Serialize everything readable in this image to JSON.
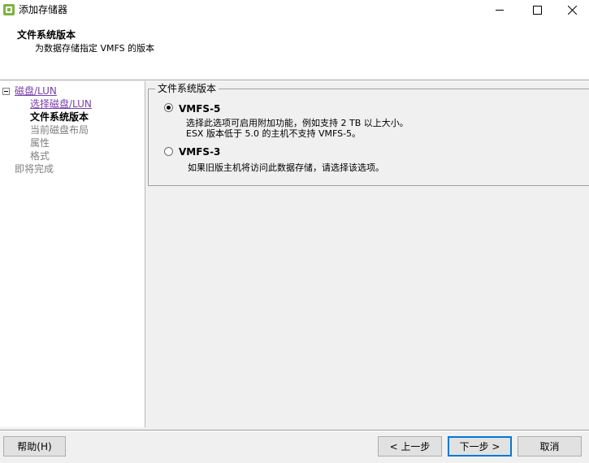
{
  "window": {
    "title": "添加存储器"
  },
  "header": {
    "title": "文件系统版本",
    "subtitle": "为数据存储指定 VMFS 的版本"
  },
  "nav": {
    "items": [
      {
        "label": "磁盘/LUN",
        "state": "link"
      },
      {
        "label": "选择磁盘/LUN",
        "state": "link"
      },
      {
        "label": "文件系统版本",
        "state": "current"
      },
      {
        "label": "当前磁盘布局",
        "state": "disabled"
      },
      {
        "label": "属性",
        "state": "disabled"
      },
      {
        "label": "格式",
        "state": "disabled"
      },
      {
        "label": "即将完成",
        "state": "disabled"
      }
    ]
  },
  "group": {
    "legend": "文件系统版本",
    "options": [
      {
        "label": "VMFS-5",
        "selected": true,
        "desc": [
          "选择此选项可启用附加功能，例如支持 2 TB 以上大小。",
          "ESX 版本低于 5.0 的主机不支持 VMFS-5。"
        ]
      },
      {
        "label": "VMFS-3",
        "selected": false,
        "desc": [
          "如果旧版主机将访问此数据存储，请选择该选项。"
        ]
      }
    ]
  },
  "buttons": {
    "help": "帮助(H)",
    "back": "< 上一步",
    "next": "下一步 >",
    "cancel": "取消"
  },
  "colors": {
    "link": "#7a3fa8",
    "disabled": "#808080",
    "panel": "#f0f0f0",
    "default_button_border": "#0078d7"
  }
}
